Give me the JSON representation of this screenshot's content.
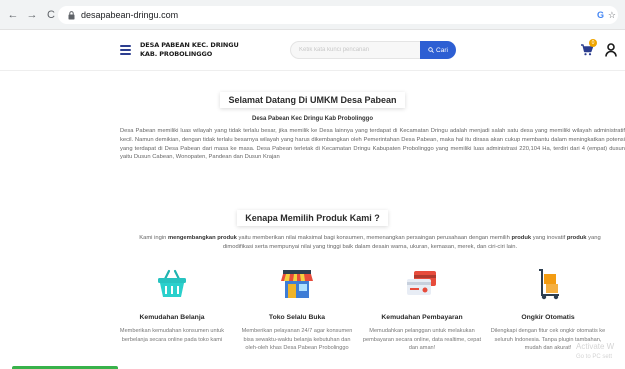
{
  "browser": {
    "url": "desapabean-dringu.com",
    "back_icon": "←",
    "forward_icon": "→",
    "reload_icon": "C",
    "right_icon": "G",
    "star_icon": "☆"
  },
  "header": {
    "brand_line1": "DESA PABEAN KEC. DRINGU",
    "brand_line2": "KAB. PROBOLINGGO",
    "search_placeholder": "Ketik kata kunci pencarian",
    "search_button": "Cari",
    "cart_count": "0"
  },
  "welcome": {
    "title": "Selamat Datang Di UMKM Desa Pabean",
    "subtitle": "Desa Pabean Kec Dringu Kab Probolinggo",
    "paragraph": "Desa Pabean memiliki luas wilayah yang tidak terlalu besar, jika memilik ke Desa lainnya yang terdapat di Kecamatan Dringu adalah menjadi salah satu desa yang memiliki wilayah administratif kecil. Namun demikian, dengan tidak terlalu besarnya wilayah yang harus dikembangkan oleh Pemerintahan Desa Pabean, maka hal itu dirasa akan cukup membantu dalam meningkatkan potensi yang terdapat di Desa Pabean dari masa ke masa. Desa Pabean terletak di Kecamatan Dringu Kabupaten Probolinggo yang memiliki luas administrasi 220,104 Ha, terdiri dari 4 (empat) dusun yaitu Dusun Cabean, Wonopaten, Pandean dan Dusun Krajan"
  },
  "why": {
    "title": "Kenapa Memilih Produk Kami ?",
    "text_1": "Kami ingin ",
    "bold_1": "mengembangkan produk",
    "text_2": " yaitu memberikan nilai maksimal bagi konsumen, memenangkan persaingan perusahaan dengan memilih ",
    "bold_2": "produk",
    "text_3": " yang inovatif ",
    "bold_3": "produk",
    "text_4": " yang dimodifikasi serta mempunyai nilai yang tinggi baik dalam desain warna, ukuran, kemasan, merek, dan ciri-ciri lain."
  },
  "features": [
    {
      "title": "Kemudahan Belanja",
      "desc": "Memberikan kemudahan konsumen untuk berbelanja secara online pada toko kami",
      "icon": "basket-icon"
    },
    {
      "title": "Toko Selalu Buka",
      "desc": "Memberikan pelayanan 24/7 agar konsumen bisa sewaktu-waktu belanja kebutuhan dan oleh-oleh khas Desa Pabean Probolinggo",
      "icon": "store-icon"
    },
    {
      "title": "Kemudahan Pembayaran",
      "desc": "Memudahkan pelanggan untuk melakukan pembayaran secara online, data realtime, cepat dan aman!",
      "icon": "payment-card-icon"
    },
    {
      "title": "Ongkir Otomatis",
      "desc": "Dilengkapi dengan fitur cek ongkir otomatis ke seluruh Indonesia. Tanpa plugin tambahan, mudah dan akurat!",
      "icon": "delivery-cart-icon"
    }
  ],
  "watermark": {
    "line1": "Activate W",
    "line2": "Go to PC sett"
  },
  "colors": {
    "accent": "#2d5fd3",
    "brand_dark": "#2c3e8f",
    "badge": "#f0a500",
    "green": "#38b24a"
  }
}
